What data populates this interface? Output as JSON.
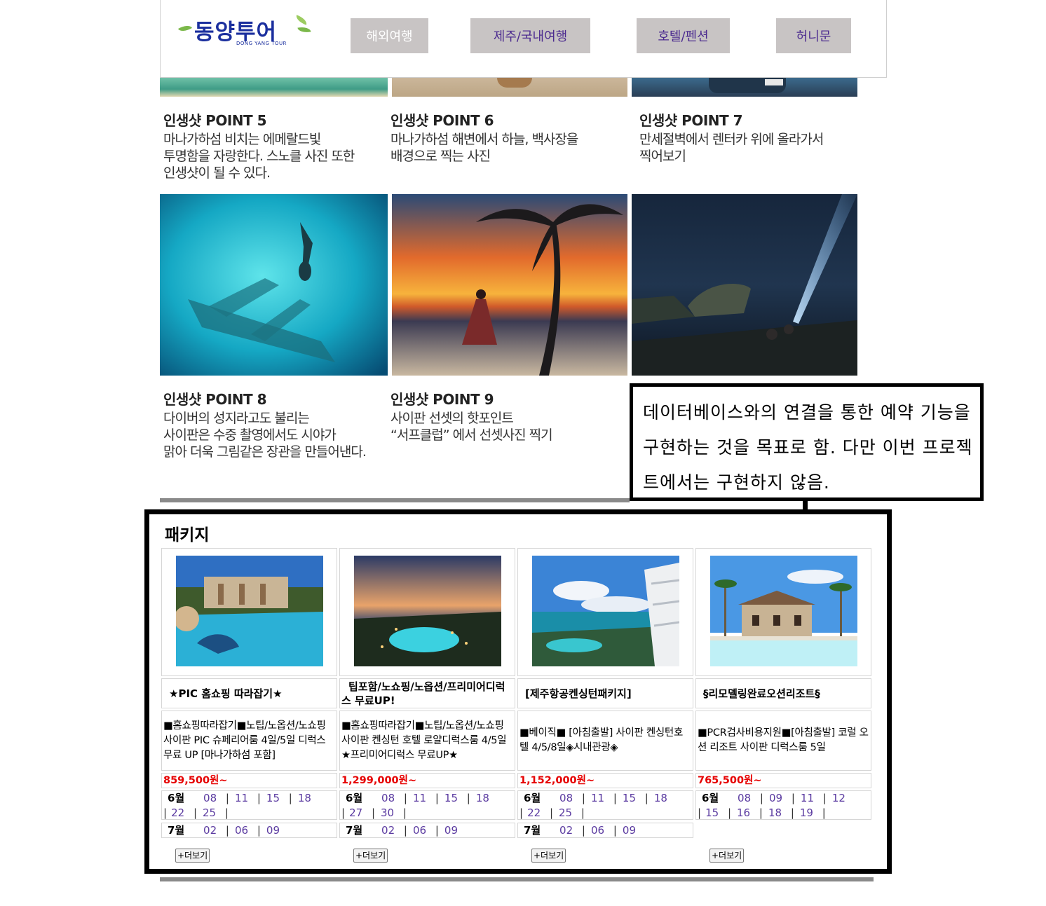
{
  "header": {
    "logo_text": "동양투어",
    "logo_subtitle": "DONG YANG TOUR",
    "nav": [
      {
        "label": "해외여행",
        "active": true
      },
      {
        "label": "제주/국내여행",
        "active": false
      },
      {
        "label": "호텔/펜션",
        "active": false
      },
      {
        "label": "허니문",
        "active": false
      }
    ]
  },
  "points": [
    {
      "title": "인생샷 POINT 5",
      "body": "마나가하섬 비치는 에메랄드빛\n투명함을 자랑한다. 스노클 사진 또한\n인생샷이 될 수 있다."
    },
    {
      "title": "인생샷 POINT 6",
      "body": "마나가하섬 해변에서 하늘, 백사장을\n배경으로 찍는 사진"
    },
    {
      "title": "인생샷 POINT 7",
      "body": "만세절벽에서 렌터카 위에 올라가서\n찍어보기"
    },
    {
      "title": "인생샷 POINT 8",
      "body": "다이버의 성지라고도 불리는\n사이판은 수중 촬영에서도 시야가\n맑아 더욱 그림같은 장관을 만들어낸다."
    },
    {
      "title": "인생샷 POINT 9",
      "body": "사이판 선셋의 핫포인트\n“서프클럽” 에서 선셋사진 찍기"
    }
  ],
  "callout": {
    "text": "데이터베이스와의 연결을 통한 예약 기능을 구현하는 것을 목표로 함. 다만 이번 프로젝트에서는 구현하지 않음."
  },
  "packages": {
    "title": "패키지",
    "more_label": "+더보기",
    "items": [
      {
        "name": "★PIC 홈쇼핑 따라잡기★",
        "desc": "■홈쇼핑따라잡기■노팁/노옵션/노쇼핑 사이판 PIC 슈페리어룸 4일/5일 디럭스 무료 UP [마나가하섬 포함]",
        "price": "859,500원~",
        "month1": "6월",
        "dates1": [
          "08",
          "11",
          "15",
          "18",
          "22",
          "25"
        ],
        "month2": "7월",
        "dates2": [
          "02",
          "06",
          "09"
        ]
      },
      {
        "name": "팁포함/노쇼핑/노옵션/프리미어디럭스 무료UP!",
        "desc": "■홈쇼핑따라잡기■노팁/노옵션/노쇼핑 사이판 켄싱턴 호텔 로얄디럭스룸 4/5일★프리미어디럭스 무료UP★",
        "price": "1,299,000원~",
        "month1": "6월",
        "dates1": [
          "08",
          "11",
          "15",
          "18",
          "27",
          "30"
        ],
        "month2": "7월",
        "dates2": [
          "02",
          "06",
          "09"
        ]
      },
      {
        "name": "[제주항공켄싱턴패키지]",
        "desc": "■베이직■ [아침출발] 사이판 켄싱턴호텔 4/5/8일◈시내관광◈",
        "price": "1,152,000원~",
        "month1": "6월",
        "dates1": [
          "08",
          "11",
          "15",
          "18",
          "22",
          "25"
        ],
        "month2": "7월",
        "dates2": [
          "02",
          "06",
          "09"
        ]
      },
      {
        "name": "§리모델링완료오션리조트§",
        "desc": "■PCR검사비용지원■[아침출발] 코럴 오션 리조트 사이판 디럭스룸 5일",
        "price": "765,500원~",
        "month1": "6월",
        "dates1": [
          "08",
          "09",
          "11",
          "12",
          "15",
          "16",
          "18",
          "19"
        ],
        "month2": "",
        "dates2": []
      }
    ]
  },
  "colors": {
    "nav_bg": "#c8c4c4",
    "nav_text": "#4b2a8f",
    "price": "#e60000",
    "date_link": "#5a3aa0",
    "logo": "#1b2f9e"
  }
}
